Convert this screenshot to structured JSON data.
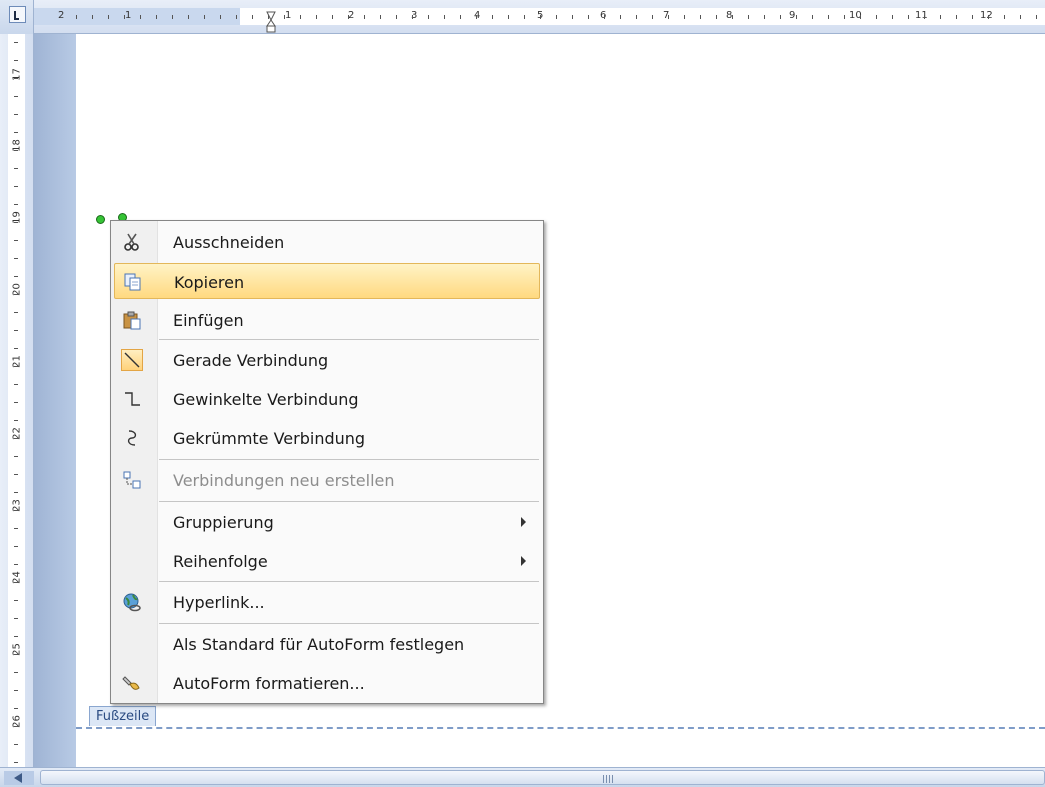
{
  "ruler": {
    "top_labels": [
      "2",
      "1",
      "1",
      "2",
      "3",
      "4",
      "5",
      "6",
      "7",
      "8",
      "9",
      "10",
      "11",
      "12"
    ],
    "left_labels": [
      "17",
      "18",
      "19",
      "20",
      "21",
      "22",
      "23",
      "24",
      "25",
      "26"
    ]
  },
  "footer": {
    "label": "Fußzeile"
  },
  "context_menu": {
    "items": [
      {
        "label": "Ausschneiden",
        "icon": "scissors-icon",
        "enabled": true
      },
      {
        "label": "Kopieren",
        "icon": "copy-icon",
        "enabled": true,
        "highlighted": true
      },
      {
        "label": "Einfügen",
        "icon": "paste-icon",
        "enabled": true
      },
      {
        "label": "Gerade Verbindung",
        "icon": "straight-connector-icon",
        "enabled": true,
        "checked": true
      },
      {
        "label": "Gewinkelte Verbindung",
        "icon": "elbow-connector-icon",
        "enabled": true
      },
      {
        "label": "Gekrümmte Verbindung",
        "icon": "curved-connector-icon",
        "enabled": true
      },
      {
        "label": "Verbindungen neu erstellen",
        "icon": "reroute-connectors-icon",
        "enabled": false
      },
      {
        "label": "Gruppierung",
        "submenu": true,
        "enabled": true
      },
      {
        "label": "Reihenfolge",
        "submenu": true,
        "enabled": true
      },
      {
        "label": "Hyperlink...",
        "icon": "hyperlink-globe-icon",
        "enabled": true
      },
      {
        "label": "Als Standard für AutoForm festlegen",
        "enabled": true
      },
      {
        "label": "AutoForm formatieren...",
        "icon": "format-autoshape-icon",
        "enabled": true
      }
    ]
  },
  "colors": {
    "menu_highlight": "#ffd980",
    "ruler_bg": "#d3def0",
    "page_frame": "#a9bedb",
    "connector_handle": "#35c335"
  }
}
